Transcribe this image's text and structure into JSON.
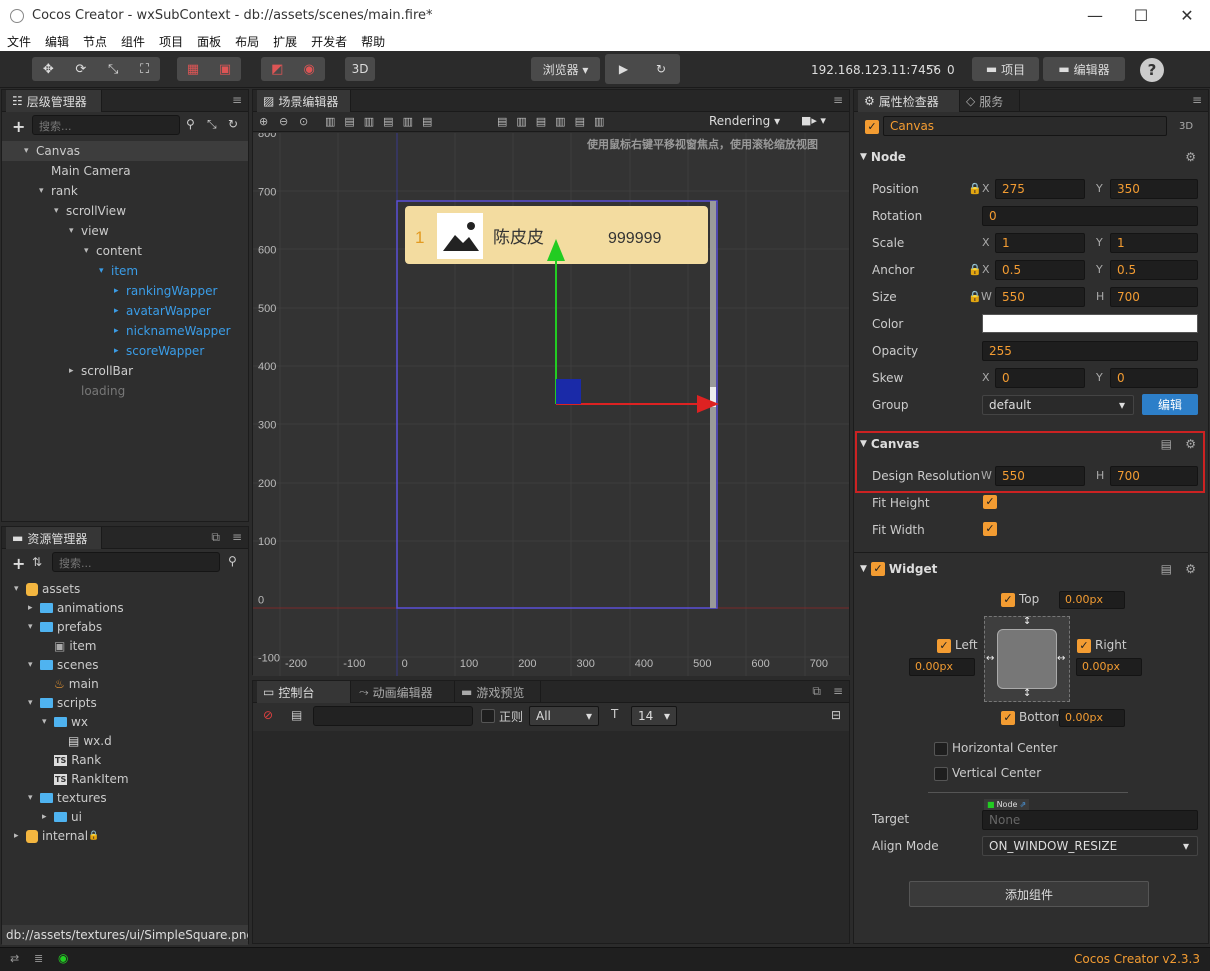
{
  "window": {
    "title": "Cocos Creator - wxSubContext - db://assets/scenes/main.fire*",
    "minimize": "—",
    "maximize": "☐",
    "close": "✕"
  },
  "menu": [
    "文件",
    "编辑",
    "节点",
    "组件",
    "项目",
    "面板",
    "布局",
    "扩展",
    "开发者",
    "帮助"
  ],
  "toolbar": {
    "mode3d": "3D",
    "browser": "浏览器 ▾",
    "play": "▶",
    "refresh": "↻",
    "ip": "192.168.123.11:7456",
    "devices": "0",
    "project": "项目",
    "editor": "编辑器",
    "help": "?"
  },
  "hierarchy": {
    "tab": "层级管理器",
    "search_placeholder": "搜索...",
    "nodes": [
      {
        "label": "Canvas",
        "indent": 0,
        "arrow": "▾",
        "style": "normal",
        "selected": true
      },
      {
        "label": "Main Camera",
        "indent": 1,
        "arrow": "",
        "style": "normal"
      },
      {
        "label": "rank",
        "indent": 1,
        "arrow": "▾",
        "style": "normal"
      },
      {
        "label": "scrollView",
        "indent": 2,
        "arrow": "▾",
        "style": "normal"
      },
      {
        "label": "view",
        "indent": 3,
        "arrow": "▾",
        "style": "normal"
      },
      {
        "label": "content",
        "indent": 4,
        "arrow": "▾",
        "style": "normal"
      },
      {
        "label": "item",
        "indent": 5,
        "arrow": "▾",
        "style": "blue"
      },
      {
        "label": "rankingWapper",
        "indent": 6,
        "arrow": "▸",
        "style": "blue"
      },
      {
        "label": "avatarWapper",
        "indent": 6,
        "arrow": "▸",
        "style": "blue"
      },
      {
        "label": "nicknameWapper",
        "indent": 6,
        "arrow": "▸",
        "style": "blue"
      },
      {
        "label": "scoreWapper",
        "indent": 6,
        "arrow": "▸",
        "style": "blue"
      },
      {
        "label": "scrollBar",
        "indent": 3,
        "arrow": "▸",
        "style": "normal"
      },
      {
        "label": "loading",
        "indent": 3,
        "arrow": "",
        "style": "gray"
      }
    ]
  },
  "assets": {
    "tab": "资源管理器",
    "search_placeholder": "搜索...",
    "nodes": [
      {
        "label": "assets",
        "indent": 0,
        "arrow": "▾",
        "icon": "db"
      },
      {
        "label": "animations",
        "indent": 1,
        "arrow": "▸",
        "icon": "folder"
      },
      {
        "label": "prefabs",
        "indent": 1,
        "arrow": "▾",
        "icon": "folder"
      },
      {
        "label": "item",
        "indent": 2,
        "arrow": "",
        "icon": "prefab"
      },
      {
        "label": "scenes",
        "indent": 1,
        "arrow": "▾",
        "icon": "folder"
      },
      {
        "label": "main",
        "indent": 2,
        "arrow": "",
        "icon": "fire"
      },
      {
        "label": "scripts",
        "indent": 1,
        "arrow": "▾",
        "icon": "folder"
      },
      {
        "label": "wx",
        "indent": 2,
        "arrow": "▾",
        "icon": "folder"
      },
      {
        "label": "wx.d",
        "indent": 3,
        "arrow": "",
        "icon": "file"
      },
      {
        "label": "Rank",
        "indent": 2,
        "arrow": "",
        "icon": "ts"
      },
      {
        "label": "RankItem",
        "indent": 2,
        "arrow": "",
        "icon": "ts"
      },
      {
        "label": "textures",
        "indent": 1,
        "arrow": "▾",
        "icon": "folder"
      },
      {
        "label": "ui",
        "indent": 2,
        "arrow": "▸",
        "icon": "folder"
      },
      {
        "label": "internal",
        "indent": 0,
        "arrow": "▸",
        "icon": "db-lock"
      }
    ],
    "path": "db://assets/textures/ui/SimpleSquare.png"
  },
  "scene": {
    "tab": "场景编辑器",
    "rendering": "Rendering",
    "hint": "使用鼠标右键平移视窗焦点，使用滚轮缩放视图",
    "y_ticks": [
      "800",
      "700",
      "600",
      "500",
      "400",
      "300",
      "200",
      "100",
      "0",
      "-100"
    ],
    "x_ticks": [
      "-200",
      "-100",
      "0",
      "100",
      "200",
      "300",
      "400",
      "500",
      "600",
      "700"
    ],
    "item": {
      "rank": "1",
      "name": "陈皮皮",
      "score": "999999"
    }
  },
  "console": {
    "tabs": [
      "控制台",
      "动画编辑器",
      "游戏预览"
    ],
    "regex": "正则",
    "filter": "All",
    "font_size": "14"
  },
  "inspector": {
    "tabs": [
      "属性检查器",
      "服务"
    ],
    "node_name": "Canvas",
    "mode3d": "3D",
    "node_section": "Node",
    "position": {
      "label": "Position",
      "x": "275",
      "y": "350"
    },
    "rotation": {
      "label": "Rotation",
      "value": "0"
    },
    "scale": {
      "label": "Scale",
      "x": "1",
      "y": "1"
    },
    "anchor": {
      "label": "Anchor",
      "x": "0.5",
      "y": "0.5"
    },
    "size": {
      "label": "Size",
      "w": "550",
      "h": "700"
    },
    "color": {
      "label": "Color",
      "value": "#ffffff"
    },
    "opacity": {
      "label": "Opacity",
      "value": "255"
    },
    "skew": {
      "label": "Skew",
      "x": "0",
      "y": "0"
    },
    "group": {
      "label": "Group",
      "value": "default",
      "edit": "编辑"
    },
    "canvas_section": "Canvas",
    "design_resolution": {
      "label": "Design Resolution",
      "w": "550",
      "h": "700"
    },
    "fit_height": "Fit Height",
    "fit_width": "Fit Width",
    "widget_section": "Widget",
    "top": {
      "label": "Top",
      "value": "0.00px"
    },
    "left": {
      "label": "Left",
      "value": "0.00px"
    },
    "right": {
      "label": "Right",
      "value": "0.00px"
    },
    "bottom": {
      "label": "Bottom",
      "value": "0.00px"
    },
    "hcenter": "Horizontal Center",
    "vcenter": "Vertical Center",
    "target": {
      "label": "Target",
      "tag": "Node",
      "value": "None"
    },
    "align_mode": {
      "label": "Align Mode",
      "value": "ON_WINDOW_RESIZE"
    },
    "add_component": "添加组件"
  },
  "status": {
    "version": "Cocos Creator v2.3.3"
  },
  "labels": {
    "x": "X",
    "y": "Y",
    "w": "W",
    "h": "H"
  }
}
